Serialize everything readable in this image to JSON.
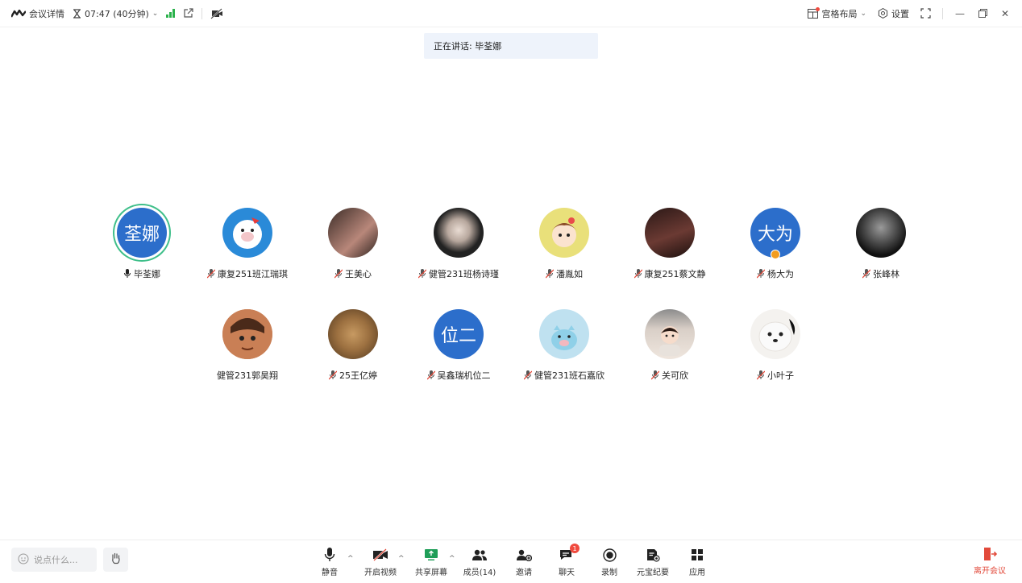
{
  "topbar": {
    "meeting_details": "会议详情",
    "timer": "07:47 (40分钟)",
    "layout_label": "宫格布局",
    "settings_label": "设置"
  },
  "speaking": {
    "label": "正在讲话: 毕荃娜"
  },
  "participants": [
    {
      "name": "毕荃娜",
      "avatar_text": "荃娜"
    },
    {
      "name": "康复251班江瑞琪",
      "avatar_text": ""
    },
    {
      "name": "王美心",
      "avatar_text": ""
    },
    {
      "name": "健管231班杨诗瑾",
      "avatar_text": ""
    },
    {
      "name": "潘胤如",
      "avatar_text": ""
    },
    {
      "name": "康复251蔡文静",
      "avatar_text": ""
    },
    {
      "name": "杨大为",
      "avatar_text": "大为"
    },
    {
      "name": "张峰林",
      "avatar_text": ""
    },
    {
      "name": "健管231郭昊翔",
      "avatar_text": ""
    },
    {
      "name": "25王亿婷",
      "avatar_text": ""
    },
    {
      "name": "吴鑫瑞机位二",
      "avatar_text": "位二"
    },
    {
      "name": "健管231班石嘉欣",
      "avatar_text": ""
    },
    {
      "name": "关可欣",
      "avatar_text": ""
    },
    {
      "name": "小叶子",
      "avatar_text": ""
    }
  ],
  "bottombar": {
    "chat_placeholder": "说点什么...",
    "tools": {
      "mute": "静音",
      "video": "开启视频",
      "share": "共享屏幕",
      "members": "成员(14)",
      "invite": "邀请",
      "chat": "聊天",
      "chat_badge": "1",
      "record": "录制",
      "notes": "元宝纪要",
      "apps": "应用"
    },
    "leave": "离开会议"
  },
  "colors": {
    "accent_blue": "#2c6ecb",
    "speaking_green": "#3fbf8a",
    "signal_green": "#2bb24c",
    "leave_red": "#e24a3b"
  }
}
